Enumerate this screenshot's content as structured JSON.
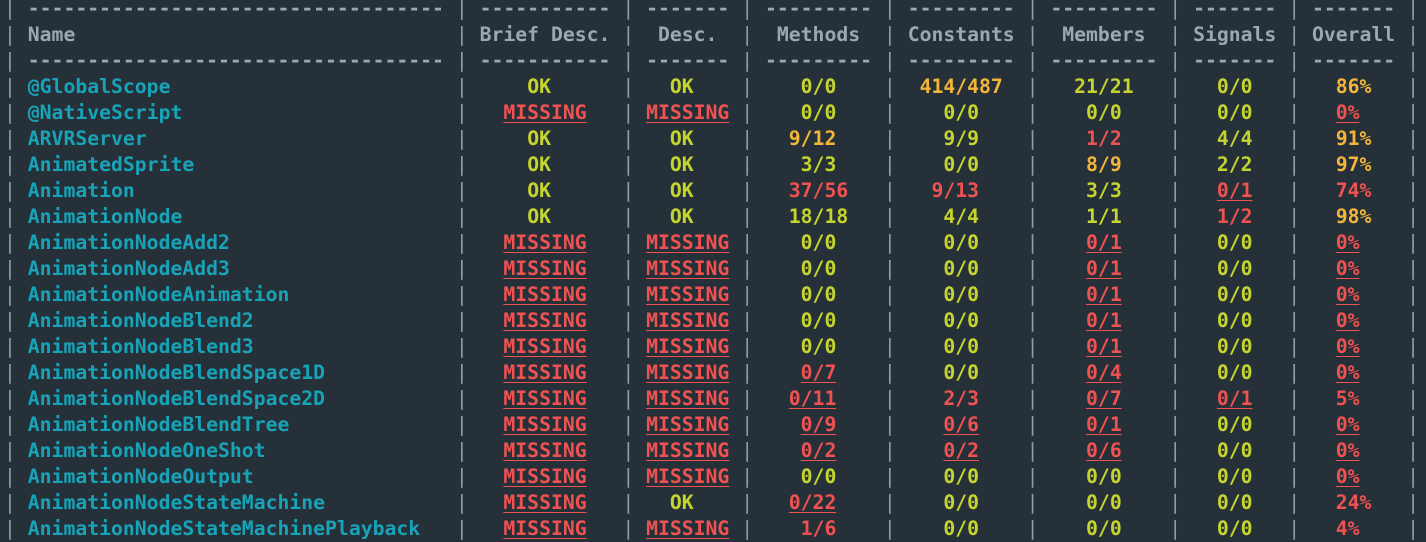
{
  "colors": {
    "background": "#263038",
    "header": "#9aa8b3",
    "name": "#17a3b8",
    "ok": "#c5d42e",
    "warn": "#f3b63a",
    "bad": "#f05252"
  },
  "columns": [
    {
      "key": "name",
      "label": "Name",
      "width": 35,
      "align": "left"
    },
    {
      "key": "brief",
      "label": "Brief Desc.",
      "width": 11,
      "align": "center"
    },
    {
      "key": "desc",
      "label": "Desc.",
      "width": 7,
      "align": "center"
    },
    {
      "key": "methods",
      "label": "Methods",
      "width": 9,
      "align": "center"
    },
    {
      "key": "constants",
      "label": "Constants",
      "width": 9,
      "align": "center"
    },
    {
      "key": "members",
      "label": "Members",
      "width": 9,
      "align": "center"
    },
    {
      "key": "signals",
      "label": "Signals",
      "width": 7,
      "align": "center"
    },
    {
      "key": "overall",
      "label": "Overall",
      "width": 7,
      "align": "center"
    }
  ],
  "rows": [
    {
      "name": "@GlobalScope",
      "brief": [
        "OK",
        "ok"
      ],
      "desc": [
        "OK",
        "ok"
      ],
      "methods": [
        "0/0",
        "ok"
      ],
      "constants": [
        "414/487",
        "warn"
      ],
      "members": [
        "21/21",
        "ok"
      ],
      "signals": [
        "0/0",
        "ok"
      ],
      "overall": [
        "86%",
        "warn"
      ]
    },
    {
      "name": "@NativeScript",
      "brief": [
        "MISSING",
        "badu"
      ],
      "desc": [
        "MISSING",
        "badu"
      ],
      "methods": [
        "0/0",
        "ok"
      ],
      "constants": [
        "0/0",
        "ok"
      ],
      "members": [
        "0/0",
        "ok"
      ],
      "signals": [
        "0/0",
        "ok"
      ],
      "overall": [
        "0%",
        "badu"
      ]
    },
    {
      "name": "ARVRServer",
      "brief": [
        "OK",
        "ok"
      ],
      "desc": [
        "OK",
        "ok"
      ],
      "methods": [
        "9/12",
        "warn"
      ],
      "constants": [
        "9/9",
        "ok"
      ],
      "members": [
        "1/2",
        "bad"
      ],
      "signals": [
        "4/4",
        "ok"
      ],
      "overall": [
        "91%",
        "warn"
      ]
    },
    {
      "name": "AnimatedSprite",
      "brief": [
        "OK",
        "ok"
      ],
      "desc": [
        "OK",
        "ok"
      ],
      "methods": [
        "3/3",
        "ok"
      ],
      "constants": [
        "0/0",
        "ok"
      ],
      "members": [
        "8/9",
        "warn"
      ],
      "signals": [
        "2/2",
        "ok"
      ],
      "overall": [
        "97%",
        "warn"
      ]
    },
    {
      "name": "Animation",
      "brief": [
        "OK",
        "ok"
      ],
      "desc": [
        "OK",
        "ok"
      ],
      "methods": [
        "37/56",
        "bad"
      ],
      "constants": [
        "9/13",
        "bad"
      ],
      "members": [
        "3/3",
        "ok"
      ],
      "signals": [
        "0/1",
        "badu"
      ],
      "overall": [
        "74%",
        "bad"
      ]
    },
    {
      "name": "AnimationNode",
      "brief": [
        "OK",
        "ok"
      ],
      "desc": [
        "OK",
        "ok"
      ],
      "methods": [
        "18/18",
        "ok"
      ],
      "constants": [
        "4/4",
        "ok"
      ],
      "members": [
        "1/1",
        "ok"
      ],
      "signals": [
        "1/2",
        "bad"
      ],
      "overall": [
        "98%",
        "warn"
      ]
    },
    {
      "name": "AnimationNodeAdd2",
      "brief": [
        "MISSING",
        "badu"
      ],
      "desc": [
        "MISSING",
        "badu"
      ],
      "methods": [
        "0/0",
        "ok"
      ],
      "constants": [
        "0/0",
        "ok"
      ],
      "members": [
        "0/1",
        "badu"
      ],
      "signals": [
        "0/0",
        "ok"
      ],
      "overall": [
        "0%",
        "badu"
      ]
    },
    {
      "name": "AnimationNodeAdd3",
      "brief": [
        "MISSING",
        "badu"
      ],
      "desc": [
        "MISSING",
        "badu"
      ],
      "methods": [
        "0/0",
        "ok"
      ],
      "constants": [
        "0/0",
        "ok"
      ],
      "members": [
        "0/1",
        "badu"
      ],
      "signals": [
        "0/0",
        "ok"
      ],
      "overall": [
        "0%",
        "badu"
      ]
    },
    {
      "name": "AnimationNodeAnimation",
      "brief": [
        "MISSING",
        "badu"
      ],
      "desc": [
        "MISSING",
        "badu"
      ],
      "methods": [
        "0/0",
        "ok"
      ],
      "constants": [
        "0/0",
        "ok"
      ],
      "members": [
        "0/1",
        "badu"
      ],
      "signals": [
        "0/0",
        "ok"
      ],
      "overall": [
        "0%",
        "badu"
      ]
    },
    {
      "name": "AnimationNodeBlend2",
      "brief": [
        "MISSING",
        "badu"
      ],
      "desc": [
        "MISSING",
        "badu"
      ],
      "methods": [
        "0/0",
        "ok"
      ],
      "constants": [
        "0/0",
        "ok"
      ],
      "members": [
        "0/1",
        "badu"
      ],
      "signals": [
        "0/0",
        "ok"
      ],
      "overall": [
        "0%",
        "badu"
      ]
    },
    {
      "name": "AnimationNodeBlend3",
      "brief": [
        "MISSING",
        "badu"
      ],
      "desc": [
        "MISSING",
        "badu"
      ],
      "methods": [
        "0/0",
        "ok"
      ],
      "constants": [
        "0/0",
        "ok"
      ],
      "members": [
        "0/1",
        "badu"
      ],
      "signals": [
        "0/0",
        "ok"
      ],
      "overall": [
        "0%",
        "badu"
      ]
    },
    {
      "name": "AnimationNodeBlendSpace1D",
      "brief": [
        "MISSING",
        "badu"
      ],
      "desc": [
        "MISSING",
        "badu"
      ],
      "methods": [
        "0/7",
        "badu"
      ],
      "constants": [
        "0/0",
        "ok"
      ],
      "members": [
        "0/4",
        "badu"
      ],
      "signals": [
        "0/0",
        "ok"
      ],
      "overall": [
        "0%",
        "badu"
      ]
    },
    {
      "name": "AnimationNodeBlendSpace2D",
      "brief": [
        "MISSING",
        "badu"
      ],
      "desc": [
        "MISSING",
        "badu"
      ],
      "methods": [
        "0/11",
        "badu"
      ],
      "constants": [
        "2/3",
        "bad"
      ],
      "members": [
        "0/7",
        "badu"
      ],
      "signals": [
        "0/1",
        "badu"
      ],
      "overall": [
        "5%",
        "bad"
      ]
    },
    {
      "name": "AnimationNodeBlendTree",
      "brief": [
        "MISSING",
        "badu"
      ],
      "desc": [
        "MISSING",
        "badu"
      ],
      "methods": [
        "0/9",
        "badu"
      ],
      "constants": [
        "0/6",
        "badu"
      ],
      "members": [
        "0/1",
        "badu"
      ],
      "signals": [
        "0/0",
        "ok"
      ],
      "overall": [
        "0%",
        "badu"
      ]
    },
    {
      "name": "AnimationNodeOneShot",
      "brief": [
        "MISSING",
        "badu"
      ],
      "desc": [
        "MISSING",
        "badu"
      ],
      "methods": [
        "0/2",
        "badu"
      ],
      "constants": [
        "0/2",
        "badu"
      ],
      "members": [
        "0/6",
        "badu"
      ],
      "signals": [
        "0/0",
        "ok"
      ],
      "overall": [
        "0%",
        "badu"
      ]
    },
    {
      "name": "AnimationNodeOutput",
      "brief": [
        "MISSING",
        "badu"
      ],
      "desc": [
        "MISSING",
        "badu"
      ],
      "methods": [
        "0/0",
        "ok"
      ],
      "constants": [
        "0/0",
        "ok"
      ],
      "members": [
        "0/0",
        "ok"
      ],
      "signals": [
        "0/0",
        "ok"
      ],
      "overall": [
        "0%",
        "badu"
      ]
    },
    {
      "name": "AnimationNodeStateMachine",
      "brief": [
        "MISSING",
        "badu"
      ],
      "desc": [
        "OK",
        "ok"
      ],
      "methods": [
        "0/22",
        "badu"
      ],
      "constants": [
        "0/0",
        "ok"
      ],
      "members": [
        "0/0",
        "ok"
      ],
      "signals": [
        "0/0",
        "ok"
      ],
      "overall": [
        "24%",
        "bad"
      ]
    },
    {
      "name": "AnimationNodeStateMachinePlayback",
      "brief": [
        "MISSING",
        "badu"
      ],
      "desc": [
        "MISSING",
        "badu"
      ],
      "methods": [
        "1/6",
        "bad"
      ],
      "constants": [
        "0/0",
        "ok"
      ],
      "members": [
        "0/0",
        "ok"
      ],
      "signals": [
        "0/0",
        "ok"
      ],
      "overall": [
        "4%",
        "bad"
      ]
    }
  ]
}
